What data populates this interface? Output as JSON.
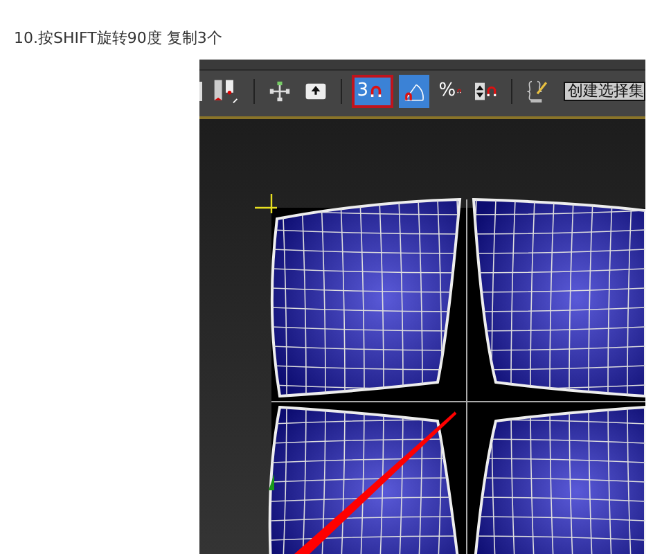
{
  "caption": "10.按SHIFT旋转90度 复制3个",
  "toolbar": {
    "items": [
      {
        "kind": "keys",
        "on": false
      },
      {
        "kind": "divider"
      },
      {
        "kind": "pivot",
        "on": false
      },
      {
        "kind": "mirror",
        "on": false
      },
      {
        "kind": "divider"
      },
      {
        "kind": "snap",
        "label": "3",
        "on": true,
        "selected": true
      },
      {
        "kind": "angle",
        "on": true
      },
      {
        "kind": "percent",
        "label": "%",
        "on": false
      },
      {
        "kind": "spinner",
        "on": false
      },
      {
        "kind": "divider"
      },
      {
        "kind": "named",
        "on": false
      }
    ],
    "selection_set": {
      "value": "创建选择集"
    }
  }
}
